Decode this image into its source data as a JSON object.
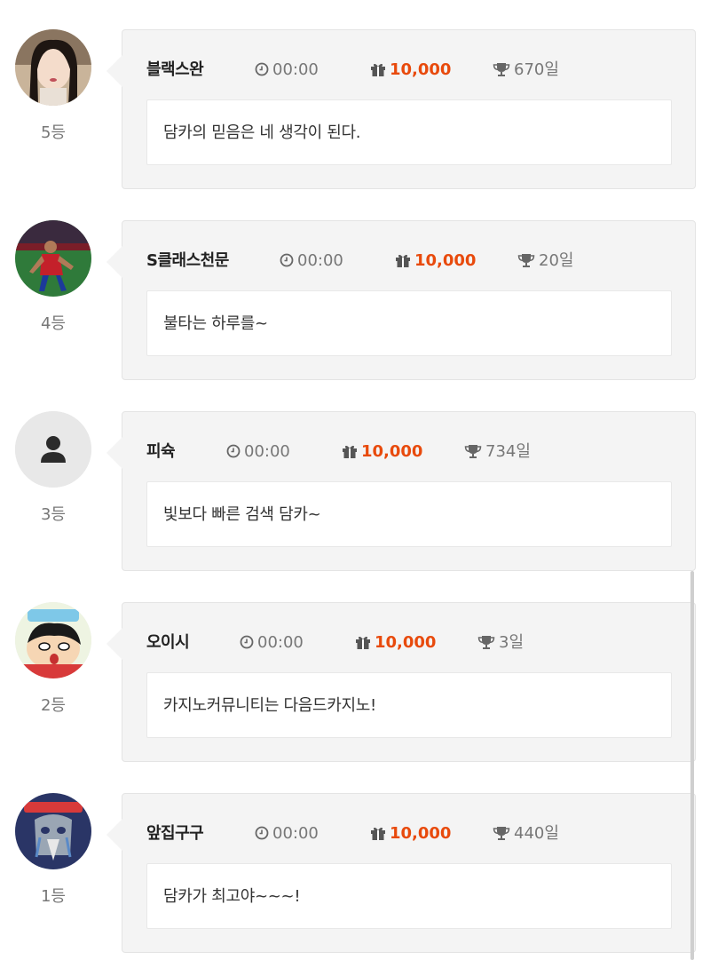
{
  "entries": [
    {
      "rank": "5등",
      "name": "블랙스완",
      "time": "00:00",
      "points": "10,000",
      "days": "670일",
      "message": "담카의 믿음은 네 생각이 된다."
    },
    {
      "rank": "4등",
      "name": "S클래스천문",
      "time": "00:00",
      "points": "10,000",
      "days": "20일",
      "message": "불타는 하루를~"
    },
    {
      "rank": "3등",
      "name": "피슉",
      "time": "00:00",
      "points": "10,000",
      "days": "734일",
      "message": "빛보다 빠른 검색 담카~"
    },
    {
      "rank": "2등",
      "name": "오이시",
      "time": "00:00",
      "points": "10,000",
      "days": "3일",
      "message": "카지노커뮤니티는 다음드카지노!"
    },
    {
      "rank": "1등",
      "name": "앞집구구",
      "time": "00:00",
      "points": "10,000",
      "days": "440일",
      "message": "담카가 최고야~~~!"
    }
  ],
  "icons": {
    "time": "clock-icon",
    "points": "gift-icon",
    "days": "trophy-icon"
  },
  "colors": {
    "points": "#e84a0c",
    "card_bg": "#f4f4f4"
  }
}
